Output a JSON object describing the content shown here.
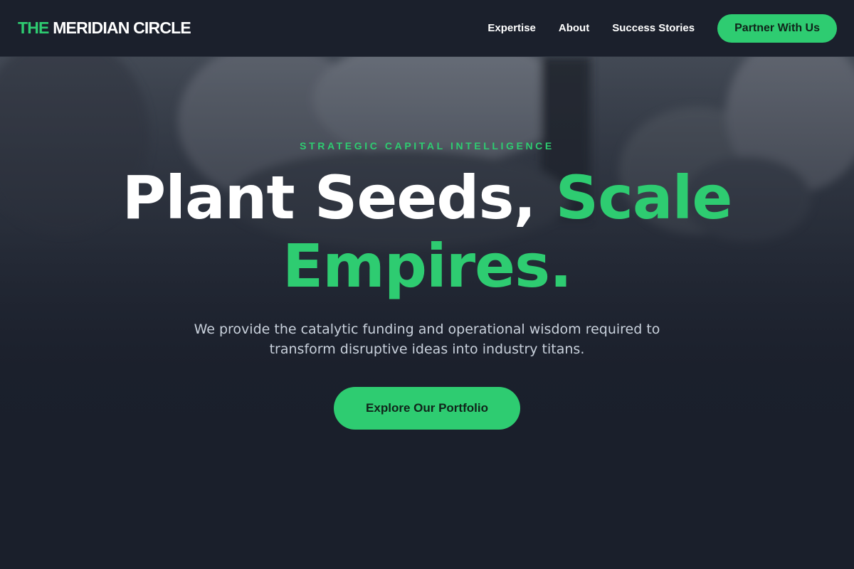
{
  "header": {
    "logo_accent": "THE",
    "logo_main": "MERIDIAN CIRCLE",
    "nav": [
      {
        "label": "Expertise"
      },
      {
        "label": "About"
      },
      {
        "label": "Success Stories"
      }
    ],
    "cta_label": "Partner With Us"
  },
  "hero": {
    "eyebrow": "STRATEGIC CAPITAL INTELLIGENCE",
    "headline_part1": "Plant Seeds,",
    "headline_part2": "Scale",
    "headline_part3": "Empires.",
    "subtext_line1": "We provide the catalytic funding and operational wisdom required to",
    "subtext_line2": "transform disruptive ideas into industry titans.",
    "cta_label": "Explore Our Portfolio",
    "background_image": "business-handshake-photo"
  },
  "colors": {
    "accent": "#2ecc71",
    "background": "#1a1f2b",
    "header_bg": "#1b202c",
    "text_primary": "#ffffff",
    "text_secondary": "#c9d1dc"
  }
}
